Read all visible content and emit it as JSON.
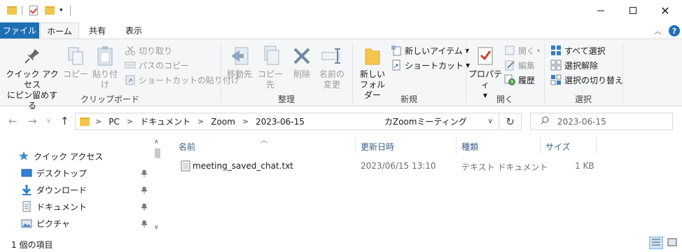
{
  "title_bar": {
    "minimize": "—",
    "maximize": "□",
    "close": "✕"
  },
  "ribbon_tabs": [
    "ファイル",
    "ホーム",
    "共有",
    "表示"
  ],
  "ribbon": {
    "clipboard": {
      "label": "クリップボード",
      "pin_quick_access": [
        "クイック アクセス",
        "にピン留めする"
      ],
      "copy": "コピー",
      "paste": "貼り付け",
      "cut": "切り取り",
      "copy_path": "パスのコピー",
      "paste_shortcut": "ショートカットの貼り付け"
    },
    "organize": {
      "label": "整理",
      "move_to": "移動先",
      "copy_to": "コピー先",
      "delete": "削除",
      "rename": [
        "名前の",
        "変更"
      ]
    },
    "new": {
      "label": "新規",
      "new_folder": [
        "新しい",
        "フォルダー"
      ],
      "new_item": "新しいアイテム",
      "shortcut": "ショートカット"
    },
    "open": {
      "label": "開く",
      "properties": "プロパティ",
      "open": "開く",
      "edit": "編集",
      "history": "履歴"
    },
    "select": {
      "label": "選択",
      "select_all": "すべて選択",
      "select_none": "選択解除",
      "invert": "選択の切り替え"
    }
  },
  "address_bar": {
    "segments": [
      "PC",
      "ドキュメント",
      "Zoom",
      "2023-06-15"
    ],
    "trailing": "カZoomミーティング",
    "refresh": "↻",
    "search_placeholder": "2023-06-15"
  },
  "nav_pane": {
    "items": [
      "クイック アクセス",
      "デスクトップ",
      "ダウンロード",
      "ドキュメント",
      "ピクチャ"
    ]
  },
  "file_list": {
    "columns": [
      "名前",
      "更新日時",
      "種類",
      "サイズ"
    ],
    "rows": [
      {
        "name": "meeting_saved_chat.txt",
        "modified": "2023/06/15 13:10",
        "type": "テキスト ドキュメント",
        "size": "1 KB"
      }
    ]
  },
  "status_bar": {
    "item_count": "1 個の項目"
  },
  "colors": {
    "file_tab": "#1f6fb5",
    "folder": "#f4c54c",
    "accent": "#1f6fb5"
  }
}
